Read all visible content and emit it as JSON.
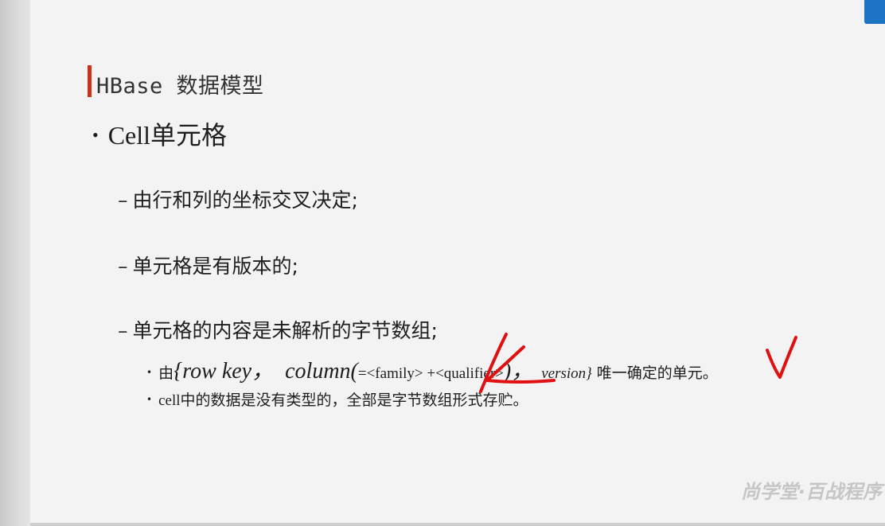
{
  "slide": {
    "title": "HBase 数据模型",
    "bullet": "Cell单元格",
    "subitems": [
      "由行和列的坐标交叉决定;",
      "单元格是有版本的;",
      "单元格的内容是未解析的字节数组;"
    ],
    "detail_1": {
      "prefix": "由",
      "rowkey": "{row key，",
      "column": "column(",
      "family": "=<family> +<qualifier>",
      "close": ")，",
      "version": "version}",
      "suffix": "唯一确定的单元。"
    },
    "detail_2": {
      "cell_word": "cell",
      "text": "中的数据是没有类型的，全部是字节数组形式存贮。"
    },
    "dash_char": "–",
    "bullet_char": "•"
  },
  "watermark": "尚学堂·百战程序",
  "colors": {
    "accent_bar": "#c83218",
    "annotation_ink": "#e01010",
    "corner_tab": "#1d73c4"
  }
}
